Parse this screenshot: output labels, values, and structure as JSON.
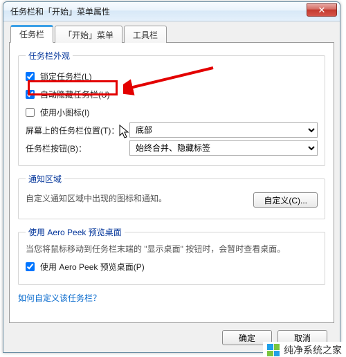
{
  "window": {
    "title": "任务栏和「开始」菜单属性",
    "close_glyph": "✕"
  },
  "tabs": [
    {
      "label": "任务栏"
    },
    {
      "label": "「开始」菜单"
    },
    {
      "label": "工具栏"
    }
  ],
  "appearance": {
    "legend": "任务栏外观",
    "lock": {
      "label": "锁定任务栏(L)",
      "checked": true
    },
    "autohide": {
      "label": "自动隐藏任务栏(U)",
      "checked": true
    },
    "smallicons": {
      "label": "使用小图标(I)",
      "checked": false
    },
    "position_label": "屏幕上的任务栏位置(T)：",
    "position_value": "底部",
    "buttons_label": "任务栏按钮(B)：",
    "buttons_value": "始终合并、隐藏标签"
  },
  "notify": {
    "legend": "通知区域",
    "desc": "自定义通知区域中出现的图标和通知。",
    "customize_btn": "自定义(C)..."
  },
  "aero": {
    "legend": "使用 Aero Peek 预览桌面",
    "desc": "当您将鼠标移动到任务栏末端的 \"显示桌面\" 按钮时，会暂时查看桌面。",
    "check": {
      "label": "使用 Aero Peek 预览桌面(P)",
      "checked": true
    }
  },
  "help_link": "如何自定义该任务栏？",
  "footer": {
    "ok": "确定",
    "cancel": "取消"
  },
  "watermark": "纯净系统之家"
}
